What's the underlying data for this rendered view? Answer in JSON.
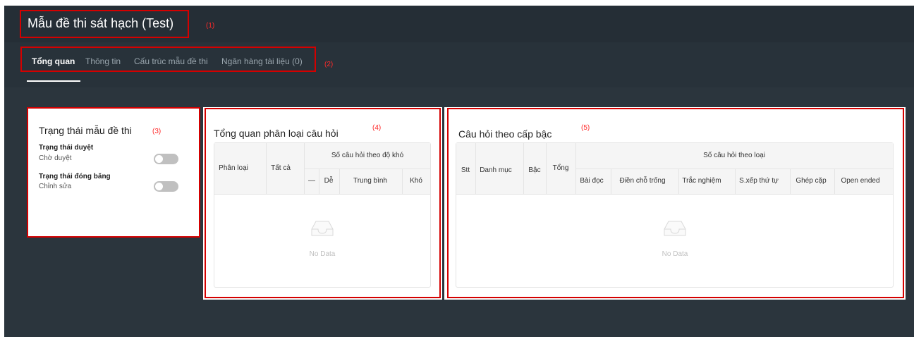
{
  "header": {
    "title": "Mẫu đề thi sát hạch (Test)"
  },
  "annotations": {
    "a1": "(1)",
    "a2": "(2)",
    "a3": "(3)",
    "a4": "(4)",
    "a5": "(5)"
  },
  "tabs": [
    {
      "label": "Tổng quan",
      "active": true
    },
    {
      "label": "Thông tin"
    },
    {
      "label": "Cấu trúc mẫu đề thi"
    },
    {
      "label": "Ngân hàng tài liệu (0)"
    }
  ],
  "status_card": {
    "title": "Trạng thái mẫu đề thi",
    "approval_label": "Trạng thái duyệt",
    "approval_value": "Chờ duyệt",
    "approval_on": false,
    "freeze_label": "Trạng thái đóng băng",
    "freeze_value": "Chỉnh sửa",
    "freeze_on": false
  },
  "classification_card": {
    "title": "Tổng quan phân loại câu hỏi",
    "col_type": "Phân loại",
    "col_all": "Tất cả",
    "col_group": "Số câu hỏi theo độ khó",
    "sub_dash": "—",
    "sub_easy": "Dễ",
    "sub_medium": "Trung bình",
    "sub_hard": "Khó",
    "empty": "No Data"
  },
  "level_card": {
    "title": "Câu hỏi theo cấp bậc",
    "col_stt": "Stt",
    "col_category": "Danh mục",
    "col_level": "Bậc",
    "col_total": "Tổng",
    "col_group": "Số câu hỏi theo loại",
    "sub_reading": "Bài đọc",
    "sub_fill": "Điền chỗ trống",
    "sub_mc": "Trắc nghiệm",
    "sub_order": "S.xếp thứ tự",
    "sub_match": "Ghép cặp",
    "sub_open": "Open ended",
    "empty": "No Data"
  },
  "colors": {
    "header_bg": "#252e36",
    "page_bg": "#2b353d",
    "annotation": "#d40000",
    "toggle_off": "#c0c0c0"
  }
}
